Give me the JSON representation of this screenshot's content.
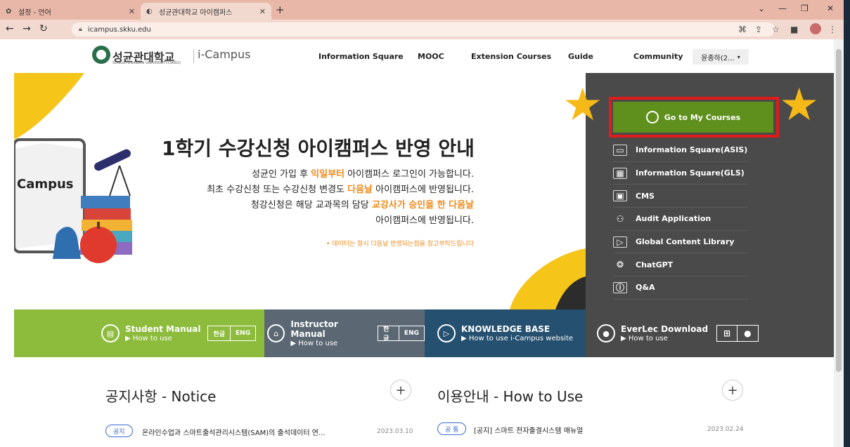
{
  "browser": {
    "tabs": [
      {
        "label": "설정 - 언어",
        "icon": "gear-icon"
      },
      {
        "label": "성균관대학교 아이캠퍼스",
        "icon": "skku-icon"
      }
    ],
    "url": "icampus.skku.edu"
  },
  "header": {
    "logo_kr": "성균관대학교",
    "logo_en": "SUNGKYUNKWAN UNIVERSITY(SKKU)",
    "logo_app": "i-Campus",
    "nav": [
      "Information Square",
      "MOOC",
      "Extension Courses",
      "Guide",
      "Community"
    ],
    "user": "윤종하(2...",
    "user_caret": "▾"
  },
  "hero": {
    "title": "1학기 수강신청 아이캠퍼스 반영 안내",
    "line1_a": "성균인 가입 후 ",
    "line1_hl": "익일부터",
    "line1_b": " 아이캠퍼스 로그인이 가능합니다.",
    "line2_a": "최초 수강신청 또는 수강신청 변경도 ",
    "line2_hl": "다음날",
    "line2_b": " 아이캠퍼스에 반영됩니다.",
    "line3_a": "청강신청은 해당 교과목의 담당 ",
    "line3_hl": "교강사가 승인을 한 다음날",
    "line4": "아이캠퍼스에 반영됩니다.",
    "note": "• 데이터는 항시 다음날 반영되는점을 참고부탁드립니다",
    "campus_text": "Campus"
  },
  "side": {
    "goto": "Go to My Courses",
    "menu": [
      "Information Square(ASIS)",
      "Information Square(GLS)",
      "CMS",
      "Audit Application",
      "Global Content Library",
      "ChatGPT",
      "Q&A"
    ]
  },
  "band": {
    "student": {
      "title": "Student Manual",
      "sub": "▶ How to use",
      "kr": "한글",
      "en": "ENG"
    },
    "instructor": {
      "title": "Instructor Manual",
      "sub": "▶ How to use",
      "kr": "한글",
      "en": "ENG"
    },
    "kb": {
      "title": "KNOWLEDGE BASE",
      "sub": "▶ How to use i-Campus website"
    },
    "everlec": {
      "title": "EverLec Download",
      "sub": "▶ How to use"
    }
  },
  "notice": {
    "title": "공지사항 - Notice",
    "plus": "+",
    "items": [
      {
        "badge": "공지",
        "text": "온라인수업과 스마트출석관리시스템(SAM)의 출석데이터 연...",
        "date": "2023.03.10"
      }
    ]
  },
  "howto": {
    "title": "이용안내 - How to Use",
    "plus": "+",
    "items": [
      {
        "badge": "공 통",
        "text": "[공지] 스마트 전자출결시스템 매뉴얼",
        "date": "2023.02.24"
      }
    ]
  },
  "colors": {
    "goto_green": "#5f8f1c",
    "highlight_orange": "#f08a1c",
    "panel_dark": "#4a4a4a",
    "band_green": "#8dbb3c",
    "band_gray": "#5b6873",
    "band_blue": "#25506f",
    "band_dark": "#4a4a4a",
    "star_yellow": "#f5b918",
    "outline_red": "#e01b1b"
  }
}
